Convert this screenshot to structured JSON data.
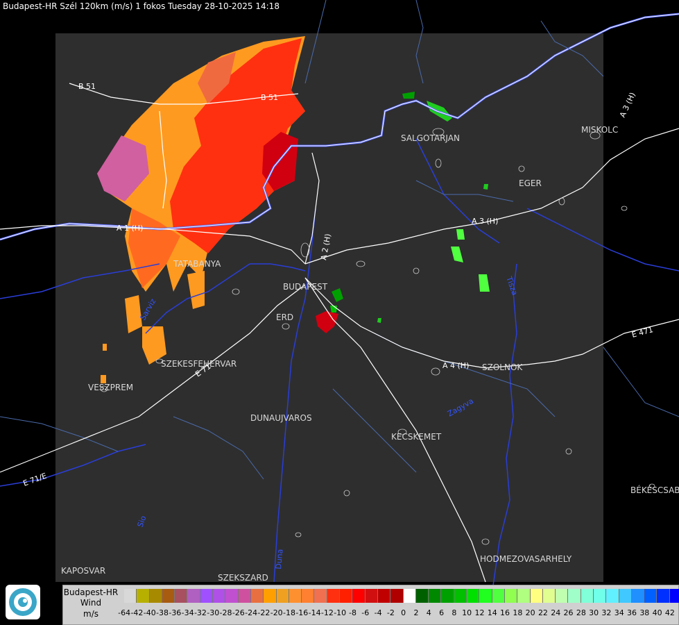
{
  "title": "Budapest-HR Szél 120km (m/s) 1 fokos Tuesday 28-10-2025 14:18",
  "cities": [
    {
      "name": "SALGOTARJAN"
    },
    {
      "name": "MISKOLC"
    },
    {
      "name": "EGER"
    },
    {
      "name": "BUDAPEST"
    },
    {
      "name": "ERD"
    },
    {
      "name": "TATABANYA"
    },
    {
      "name": "SZEKESFEHERVAR"
    },
    {
      "name": "VESZPREM"
    },
    {
      "name": "DUNAUJVAROS"
    },
    {
      "name": "KECSKEMET"
    },
    {
      "name": "SZOLNOK"
    },
    {
      "name": "KAPOSVAR"
    },
    {
      "name": "SZEKSZARD"
    },
    {
      "name": "HODMEZOVASARHELY"
    },
    {
      "name": "BÉKÉSCSAB"
    }
  ],
  "roads": [
    "B 51",
    "B 51",
    "A 3 (H)",
    "A 3 (H)",
    "A 2 (H)",
    "A 1 (H)",
    "A 4 (H)",
    "E 471",
    "E 71",
    "E 71/E"
  ],
  "rivers": [
    "Duna",
    "Sio",
    "Tisza",
    "Sarviz",
    "Zagyva"
  ],
  "legend": {
    "title_lines": [
      "Budapest-HR",
      "Wind",
      "m/s"
    ],
    "ticks": [
      "-64",
      "-42",
      "-40",
      "-38",
      "-36",
      "-34",
      "-32",
      "-30",
      "-28",
      "-26",
      "-24",
      "-22",
      "-20",
      "-18",
      "-16",
      "-14",
      "-12",
      "-10",
      "-8",
      "-6",
      "-4",
      "-2",
      "0",
      "2",
      "4",
      "6",
      "8",
      "10",
      "12",
      "14",
      "16",
      "18",
      "20",
      "22",
      "24",
      "26",
      "28",
      "30",
      "32",
      "34",
      "36",
      "38",
      "40",
      "42"
    ],
    "colors": [
      "#d8d8d8",
      "#b8b000",
      "#a88a00",
      "#a85c10",
      "#a85060",
      "#b060c0",
      "#a050ff",
      "#b050e8",
      "#c050d0",
      "#d050a0",
      "#e87040",
      "#ffa000",
      "#f0a020",
      "#ff9030",
      "#ff8030",
      "#f07050",
      "#ff3010",
      "#ff2000",
      "#ff0000",
      "#d01010",
      "#c00000",
      "#b00000",
      "#ffffff",
      "#006000",
      "#008800",
      "#00a000",
      "#00c000",
      "#00e000",
      "#20ff20",
      "#50ff40",
      "#90ff50",
      "#b0ff80",
      "#ffff80",
      "#e0ff90",
      "#c0ffb0",
      "#a0ffc8",
      "#80ffd8",
      "#70ffe8",
      "#60f0ff",
      "#40c8ff",
      "#2090ff",
      "#0060ff",
      "#0030ff",
      "#0000ff"
    ]
  }
}
